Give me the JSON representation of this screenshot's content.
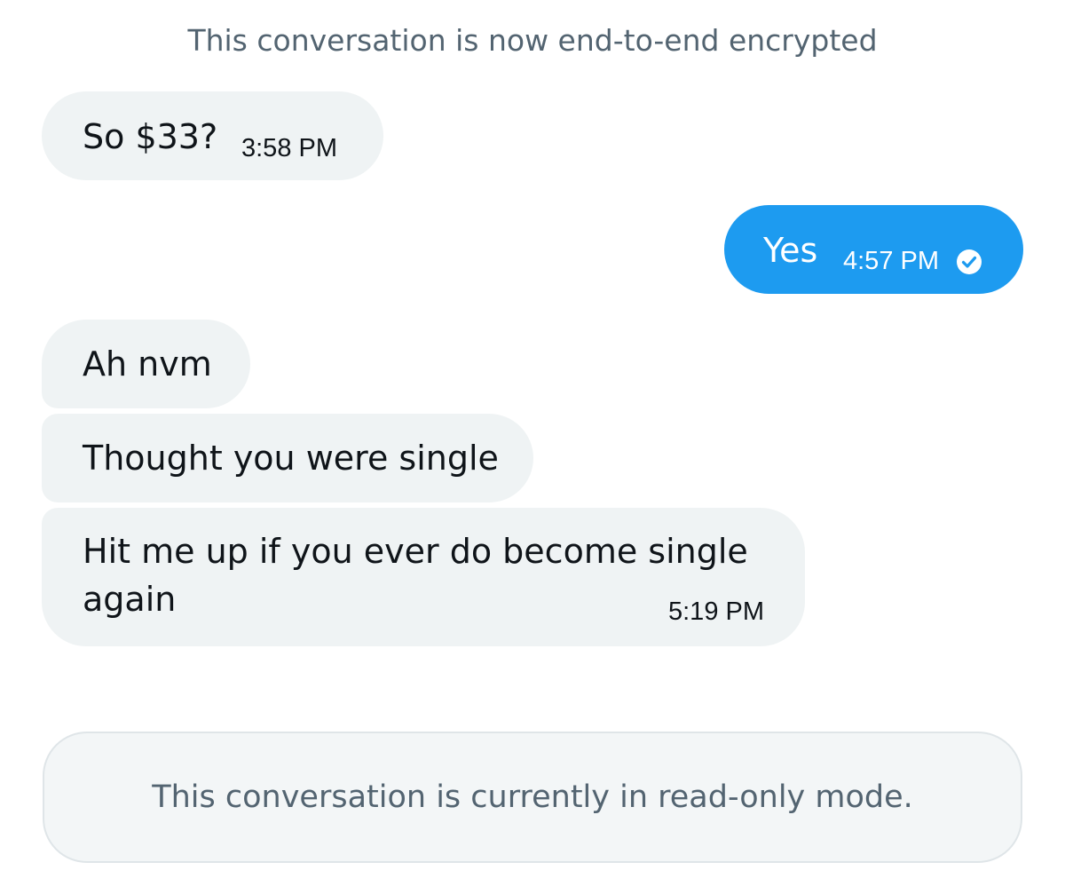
{
  "encryption_notice": "This conversation is now end-to-end encrypted",
  "messages": [
    {
      "text": "So $33?",
      "time": "3:58 PM",
      "direction": "received"
    },
    {
      "text": "Yes",
      "time": "4:57 PM",
      "direction": "sent",
      "status_icon": "check-circle-icon"
    },
    {
      "text": "Ah nvm",
      "direction": "received"
    },
    {
      "text": "Thought you were single",
      "direction": "received"
    },
    {
      "text": "Hit me up if you ever do become single again",
      "time": "5:19 PM",
      "direction": "received"
    }
  ],
  "readonly_notice": "This conversation is currently in read-only mode.",
  "colors": {
    "sent_bubble": "#1d9bf0",
    "received_bubble": "#eff3f4",
    "muted_text": "#536471"
  }
}
